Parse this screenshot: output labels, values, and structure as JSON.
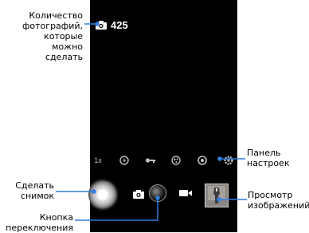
{
  "photo_counter": {
    "value": "425",
    "icon": "camera-icon"
  },
  "settings_panel": {
    "items": [
      {
        "name": "zoom-icon",
        "text": "1x"
      },
      {
        "name": "flash-icon",
        "text": ""
      },
      {
        "name": "white-balance-icon",
        "text": ""
      },
      {
        "name": "color-effect-icon",
        "text": ""
      },
      {
        "name": "scene-mode-icon",
        "text": ""
      },
      {
        "name": "settings-icon",
        "text": ""
      }
    ]
  },
  "annotations": {
    "count_line1": "Количество",
    "count_line2": "фотографий,",
    "count_line3": "которые можно",
    "count_line4": "сделать",
    "panel_line1": "Панель",
    "panel_line2": "настроек",
    "shutter_line1": "Сделать",
    "shutter_line2": "снимок",
    "switch_line1": "Кнопка",
    "switch_line2": "переключения",
    "gallery_line1": "Просмотр",
    "gallery_line2": "изображений"
  },
  "colors": {
    "accent": "#2f7ee0",
    "screen": "#000000"
  }
}
